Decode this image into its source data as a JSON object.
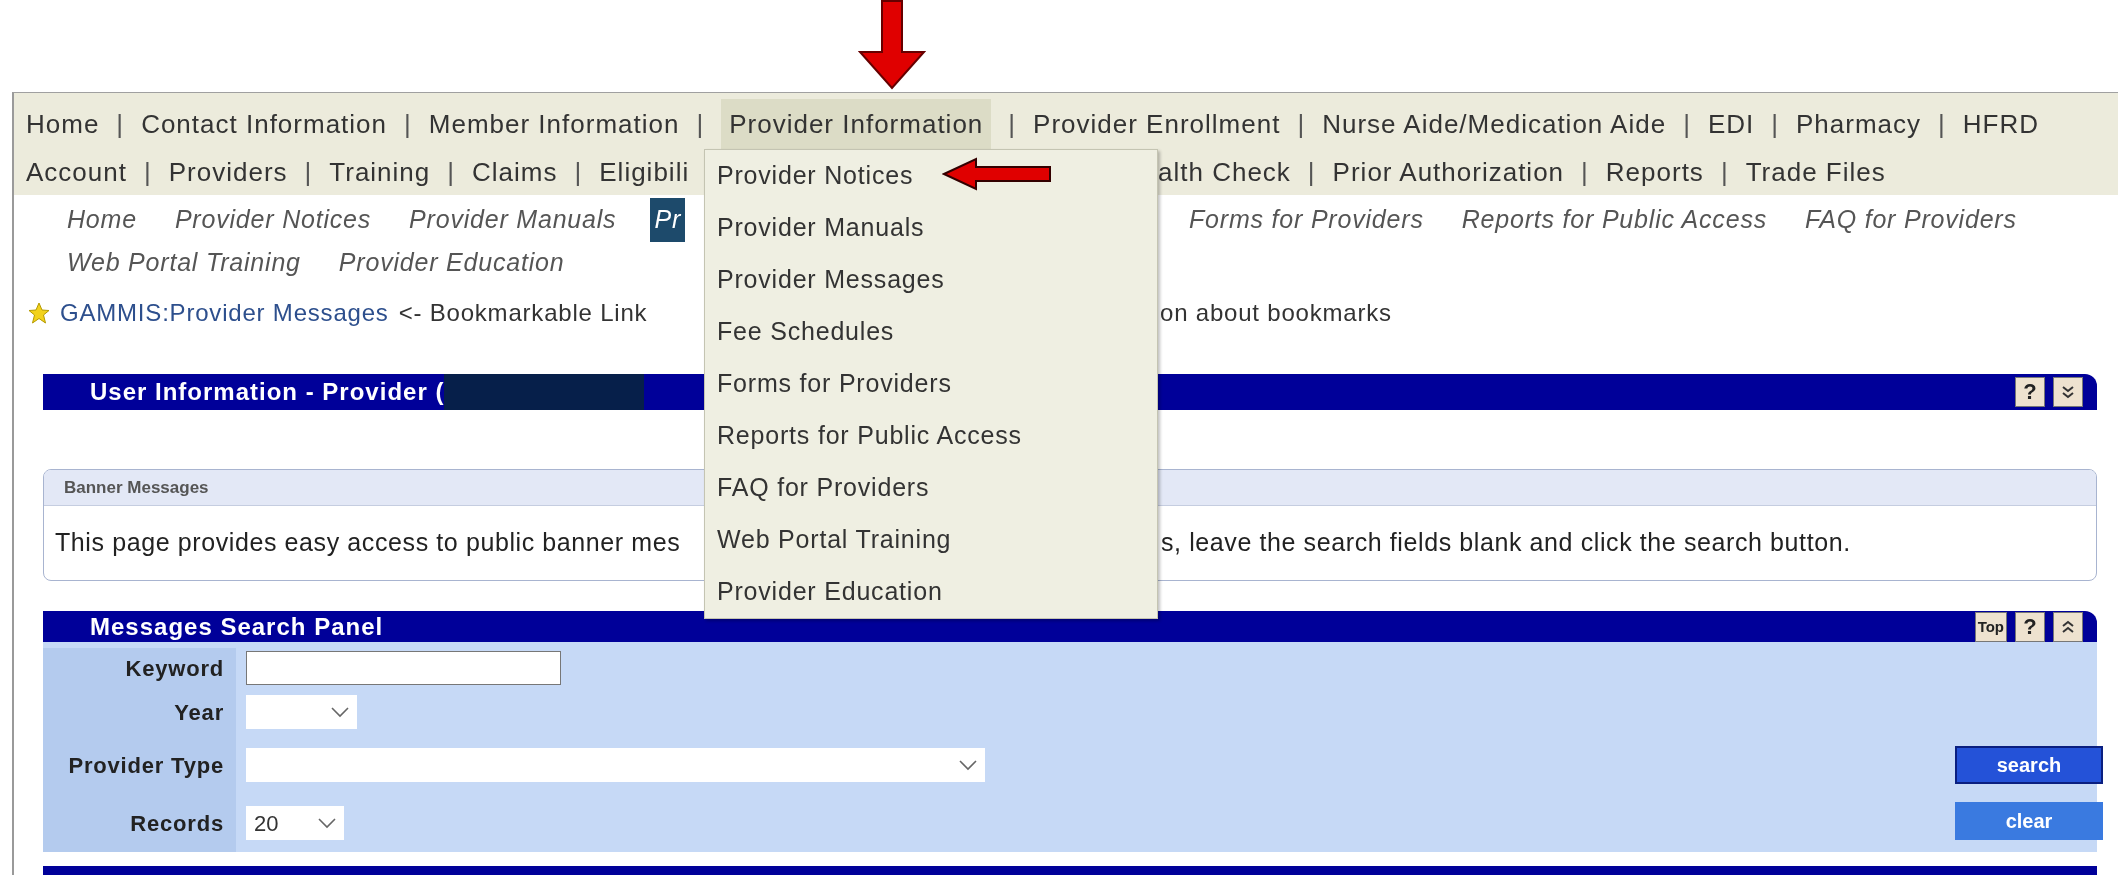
{
  "main_nav": {
    "separator": "|",
    "rows": [
      {
        "items": [
          {
            "label": "Home",
            "selected": false
          },
          {
            "label": "Contact Information",
            "selected": false
          },
          {
            "label": "Member Information",
            "selected": false
          },
          {
            "label": "Provider Information",
            "selected": true
          },
          {
            "label": "Provider Enrollment",
            "selected": false
          },
          {
            "label": "Nurse Aide/Medication Aide",
            "selected": false
          },
          {
            "label": "EDI",
            "selected": false
          },
          {
            "label": "Pharmacy",
            "selected": false
          },
          {
            "label": "HFRD",
            "selected": false
          }
        ],
        "items_after_menu": []
      },
      {
        "items": [
          {
            "label": "Account",
            "selected": false
          },
          {
            "label": "Providers",
            "selected": false
          },
          {
            "label": "Training",
            "selected": false
          },
          {
            "label": "Claims",
            "selected": false
          },
          {
            "label": "Eligibili",
            "selected": false
          }
        ],
        "items_after_menu": [
          {
            "label": "alth Check",
            "selected": false
          },
          {
            "label": "Prior Authorization",
            "selected": false
          },
          {
            "label": "Reports",
            "selected": false
          },
          {
            "label": "Trade Files",
            "selected": false
          }
        ]
      }
    ]
  },
  "dropdown": {
    "items": [
      "Provider Notices",
      "Provider Manuals",
      "Provider Messages",
      "Fee Schedules",
      "Forms for Providers",
      "Reports for Public Access",
      "FAQ for Providers",
      "Web Portal Training",
      "Provider Education"
    ]
  },
  "sub_nav": {
    "rows": [
      {
        "items": [
          {
            "label": "Home",
            "selected": false
          },
          {
            "label": "Provider Notices",
            "selected": false
          },
          {
            "label": "Provider Manuals",
            "selected": false
          },
          {
            "label": "Pr",
            "selected": true
          }
        ],
        "items_after_menu": [
          {
            "label": "Forms for Providers",
            "selected": false
          },
          {
            "label": "Reports for Public Access",
            "selected": false
          },
          {
            "label": "FAQ for Providers",
            "selected": false
          }
        ]
      },
      {
        "items": [
          {
            "label": "Web Portal Training",
            "selected": false
          },
          {
            "label": "Provider Education",
            "selected": false
          }
        ],
        "items_after_menu": []
      }
    ]
  },
  "bookmark": {
    "link": "GAMMIS:Provider Messages",
    "text": "<- Bookmarkable Link",
    "text_after_menu": "on about bookmarks"
  },
  "user_info_panel": {
    "title": "User Information - Provider (",
    "redacted": true,
    "header_buttons": [
      {
        "kind": "help",
        "label": "?"
      },
      {
        "kind": "expand"
      }
    ]
  },
  "banner_messages": {
    "title": "Banner Messages",
    "text": "This page provides easy access to public banner mes",
    "text_after_menu": "s, leave the search fields blank and click the search button."
  },
  "search_panel": {
    "title": "Messages Search Panel",
    "header_buttons": [
      {
        "kind": "top",
        "label": "Top"
      },
      {
        "kind": "help",
        "label": "?"
      },
      {
        "kind": "collapse"
      }
    ],
    "fields": [
      {
        "label": "Keyword",
        "kind": "text"
      },
      {
        "label": "Year",
        "kind": "select"
      },
      {
        "label": "Provider Type",
        "kind": "select"
      },
      {
        "label": "Records",
        "kind": "select",
        "value": "20"
      }
    ],
    "buttons": [
      {
        "label": "search",
        "kind": "primary"
      },
      {
        "label": "clear",
        "kind": "secondary"
      }
    ]
  }
}
